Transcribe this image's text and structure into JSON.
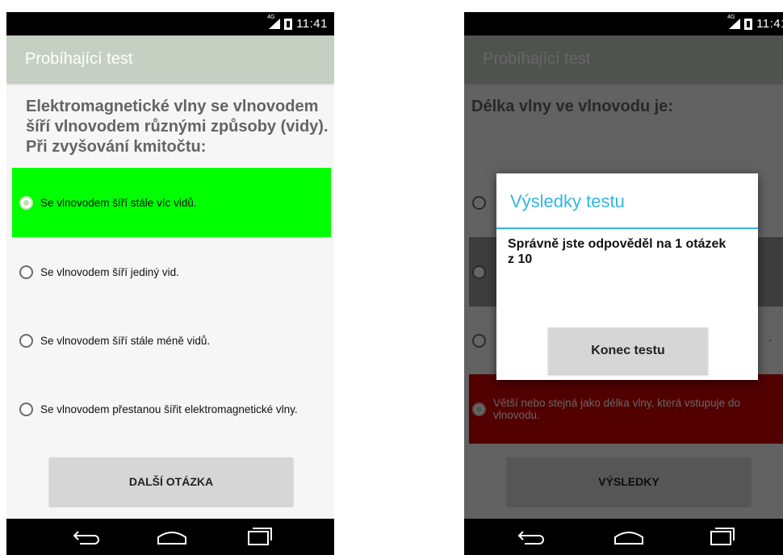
{
  "status": {
    "network": "4G",
    "time": "11:41"
  },
  "left": {
    "appbar_title": "Probíhající test",
    "question": "Elektromagnetické vlny se vlnovodem šíří vlnovodem různými způsoby (vidy). Při zvyšování kmitočtu:",
    "options": [
      {
        "label": "Se vlnovodem šíří stále víc vidů.",
        "selected": true,
        "color": "#00ff00"
      },
      {
        "label": "Se vlnovodem šíří jediný vid.",
        "selected": false
      },
      {
        "label": "Se vlnovodem šíří stále méně vidů.",
        "selected": false
      },
      {
        "label": "Se vlnovodem přestanou šířit elektromagnetické vlny.",
        "selected": false
      }
    ],
    "next_button": "DALŠÍ OTÁZKA"
  },
  "right": {
    "appbar_title": "Probíhající test",
    "question": "Délka vlny ve vlnovodu je:",
    "options": [
      {
        "label": "",
        "state": "unselected"
      },
      {
        "label": "",
        "state": "answer-highlight"
      },
      {
        "label": "",
        "state": "unselected",
        "tail": "."
      },
      {
        "label": "Větší nebo stejná jako délka vlny, která vstupuje do vlnovodu.",
        "state": "selected-wrong",
        "color": "#cc0000"
      }
    ],
    "results_button": "VÝSLEDKY",
    "dialog": {
      "title": "Výsledky testu",
      "message": "Správně jste odpověděl na 1 otázek z 10",
      "button": "Konec testu"
    }
  },
  "colors": {
    "accent": "#33b5e5",
    "correct": "#00ff00",
    "wrong": "#cc0000",
    "appbar": "#c5d0c3"
  }
}
